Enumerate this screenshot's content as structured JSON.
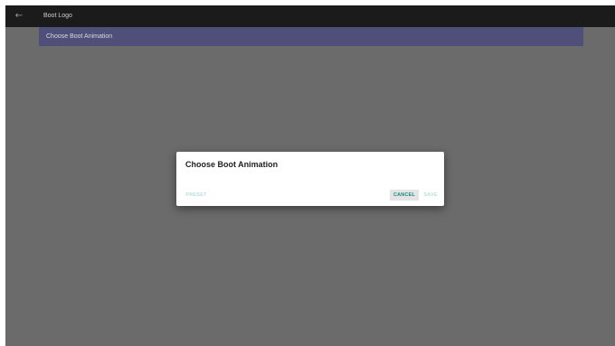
{
  "app_bar": {
    "back_icon": "arrow-back-icon",
    "back_glyph": "←",
    "title": "Boot Logo"
  },
  "list": {
    "items": [
      {
        "label": "Choose Boot Animation",
        "selected": true
      }
    ]
  },
  "dialog": {
    "title": "Choose Boot Animation",
    "buttons": {
      "preset": {
        "label": "PRESET",
        "enabled": false
      },
      "cancel": {
        "label": "CANCEL",
        "enabled": true,
        "focused": true
      },
      "save": {
        "label": "SAVE",
        "enabled": false
      }
    }
  },
  "colors": {
    "app_bar_bg": "#1b1b1b",
    "scrim_bg": "#6b6b6b",
    "selected_item_bg": "#4f4f7a",
    "accent": "#1a8a7e",
    "accent_disabled": "#b9dfdb",
    "dialog_bg": "#ffffff"
  }
}
